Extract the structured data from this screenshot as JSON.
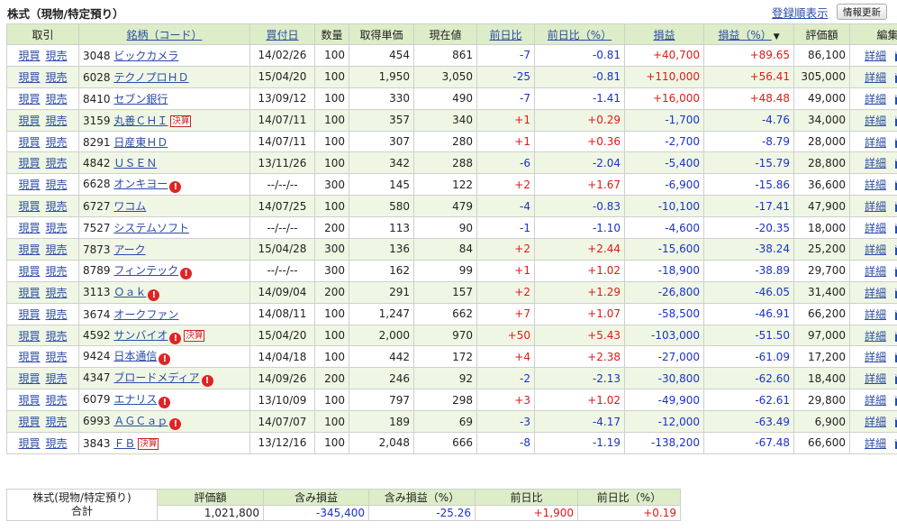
{
  "header": {
    "title": "株式（現物/特定預り）",
    "order_link": "登録順表示",
    "refresh_button": "情報更新"
  },
  "columns": [
    "取引",
    "銘柄（コード）",
    "買付日",
    "数量",
    "取得単価",
    "現在値",
    "前日比",
    "前日比（%）",
    "損益",
    "損益（%）",
    "評価額",
    "編集"
  ],
  "sort_indicator": "▼",
  "trade_labels": {
    "buy": "現買",
    "sell": "現売"
  },
  "detail_label": "詳細",
  "settle_label": "決算",
  "alert_glyph": "!",
  "rows": [
    {
      "code": "3048",
      "name": "ビックカメラ",
      "date": "14/02/26",
      "qty": "100",
      "cost": "454",
      "price": "861",
      "chg": "-7",
      "chg_pct": "-0.81",
      "pl": "+40,700",
      "pl_pct": "+89.65",
      "value": "86,100",
      "alert": false,
      "settle": false
    },
    {
      "code": "6028",
      "name": "テクノプロＨＤ",
      "date": "15/04/20",
      "qty": "100",
      "cost": "1,950",
      "price": "3,050",
      "chg": "-25",
      "chg_pct": "-0.81",
      "pl": "+110,000",
      "pl_pct": "+56.41",
      "value": "305,000",
      "alert": false,
      "settle": false
    },
    {
      "code": "8410",
      "name": "セブン銀行",
      "date": "13/09/12",
      "qty": "100",
      "cost": "330",
      "price": "490",
      "chg": "-7",
      "chg_pct": "-1.41",
      "pl": "+16,000",
      "pl_pct": "+48.48",
      "value": "49,000",
      "alert": false,
      "settle": false
    },
    {
      "code": "3159",
      "name": "丸善ＣＨＩ",
      "date": "14/07/11",
      "qty": "100",
      "cost": "357",
      "price": "340",
      "chg": "+1",
      "chg_pct": "+0.29",
      "pl": "-1,700",
      "pl_pct": "-4.76",
      "value": "34,000",
      "alert": false,
      "settle": true
    },
    {
      "code": "8291",
      "name": "日産東ＨＤ",
      "date": "14/07/11",
      "qty": "100",
      "cost": "307",
      "price": "280",
      "chg": "+1",
      "chg_pct": "+0.36",
      "pl": "-2,700",
      "pl_pct": "-8.79",
      "value": "28,000",
      "alert": false,
      "settle": false
    },
    {
      "code": "4842",
      "name": "ＵＳＥＮ",
      "date": "13/11/26",
      "qty": "100",
      "cost": "342",
      "price": "288",
      "chg": "-6",
      "chg_pct": "-2.04",
      "pl": "-5,400",
      "pl_pct": "-15.79",
      "value": "28,800",
      "alert": false,
      "settle": false
    },
    {
      "code": "6628",
      "name": "オンキヨー",
      "date": "--/--/--",
      "qty": "300",
      "cost": "145",
      "price": "122",
      "chg": "+2",
      "chg_pct": "+1.67",
      "pl": "-6,900",
      "pl_pct": "-15.86",
      "value": "36,600",
      "alert": true,
      "settle": false
    },
    {
      "code": "6727",
      "name": "ワコム",
      "date": "14/07/25",
      "qty": "100",
      "cost": "580",
      "price": "479",
      "chg": "-4",
      "chg_pct": "-0.83",
      "pl": "-10,100",
      "pl_pct": "-17.41",
      "value": "47,900",
      "alert": false,
      "settle": false
    },
    {
      "code": "7527",
      "name": "システムソフト",
      "date": "--/--/--",
      "qty": "200",
      "cost": "113",
      "price": "90",
      "chg": "-1",
      "chg_pct": "-1.10",
      "pl": "-4,600",
      "pl_pct": "-20.35",
      "value": "18,000",
      "alert": false,
      "settle": false
    },
    {
      "code": "7873",
      "name": "アーク",
      "date": "15/04/28",
      "qty": "300",
      "cost": "136",
      "price": "84",
      "chg": "+2",
      "chg_pct": "+2.44",
      "pl": "-15,600",
      "pl_pct": "-38.24",
      "value": "25,200",
      "alert": false,
      "settle": false
    },
    {
      "code": "8789",
      "name": "フィンテック",
      "date": "--/--/--",
      "qty": "300",
      "cost": "162",
      "price": "99",
      "chg": "+1",
      "chg_pct": "+1.02",
      "pl": "-18,900",
      "pl_pct": "-38.89",
      "value": "29,700",
      "alert": true,
      "settle": false
    },
    {
      "code": "3113",
      "name": "Ｏａｋ",
      "date": "14/09/04",
      "qty": "200",
      "cost": "291",
      "price": "157",
      "chg": "+2",
      "chg_pct": "+1.29",
      "pl": "-26,800",
      "pl_pct": "-46.05",
      "value": "31,400",
      "alert": true,
      "settle": false
    },
    {
      "code": "3674",
      "name": "オークファン",
      "date": "14/08/11",
      "qty": "100",
      "cost": "1,247",
      "price": "662",
      "chg": "+7",
      "chg_pct": "+1.07",
      "pl": "-58,500",
      "pl_pct": "-46.91",
      "value": "66,200",
      "alert": false,
      "settle": false
    },
    {
      "code": "4592",
      "name": "サンバイオ",
      "date": "15/04/20",
      "qty": "100",
      "cost": "2,000",
      "price": "970",
      "chg": "+50",
      "chg_pct": "+5.43",
      "pl": "-103,000",
      "pl_pct": "-51.50",
      "value": "97,000",
      "alert": true,
      "settle": true
    },
    {
      "code": "9424",
      "name": "日本通信",
      "date": "14/04/18",
      "qty": "100",
      "cost": "442",
      "price": "172",
      "chg": "+4",
      "chg_pct": "+2.38",
      "pl": "-27,000",
      "pl_pct": "-61.09",
      "value": "17,200",
      "alert": true,
      "settle": false
    },
    {
      "code": "4347",
      "name": "ブロードメディア",
      "date": "14/09/26",
      "qty": "200",
      "cost": "246",
      "price": "92",
      "chg": "-2",
      "chg_pct": "-2.13",
      "pl": "-30,800",
      "pl_pct": "-62.60",
      "value": "18,400",
      "alert": true,
      "settle": false
    },
    {
      "code": "6079",
      "name": "エナリス",
      "date": "13/10/09",
      "qty": "100",
      "cost": "797",
      "price": "298",
      "chg": "+3",
      "chg_pct": "+1.02",
      "pl": "-49,900",
      "pl_pct": "-62.61",
      "value": "29,800",
      "alert": true,
      "settle": false
    },
    {
      "code": "6993",
      "name": "ＡＧＣａｐ",
      "date": "14/07/07",
      "qty": "100",
      "cost": "189",
      "price": "69",
      "chg": "-3",
      "chg_pct": "-4.17",
      "pl": "-12,000",
      "pl_pct": "-63.49",
      "value": "6,900",
      "alert": true,
      "settle": false
    },
    {
      "code": "3843",
      "name": "ＦＢ",
      "date": "13/12/16",
      "qty": "100",
      "cost": "2,048",
      "price": "666",
      "chg": "-8",
      "chg_pct": "-1.19",
      "pl": "-138,200",
      "pl_pct": "-67.48",
      "value": "66,600",
      "alert": false,
      "settle": true
    }
  ],
  "summary": {
    "label_line1": "株式(現物/特定預り)",
    "label_line2": "合計",
    "headers": [
      "評価額",
      "含み損益",
      "含み損益（%）",
      "前日比",
      "前日比（%）"
    ],
    "values": [
      "1,021,800",
      "-345,400",
      "-25.26",
      "+1,900",
      "+0.19"
    ]
  },
  "colors": {
    "header_bg": "#dcedc8",
    "alt_row_bg": "#eff7e4",
    "positive": "#e01818",
    "negative": "#1a32c8",
    "link": "#2b4ba5"
  }
}
